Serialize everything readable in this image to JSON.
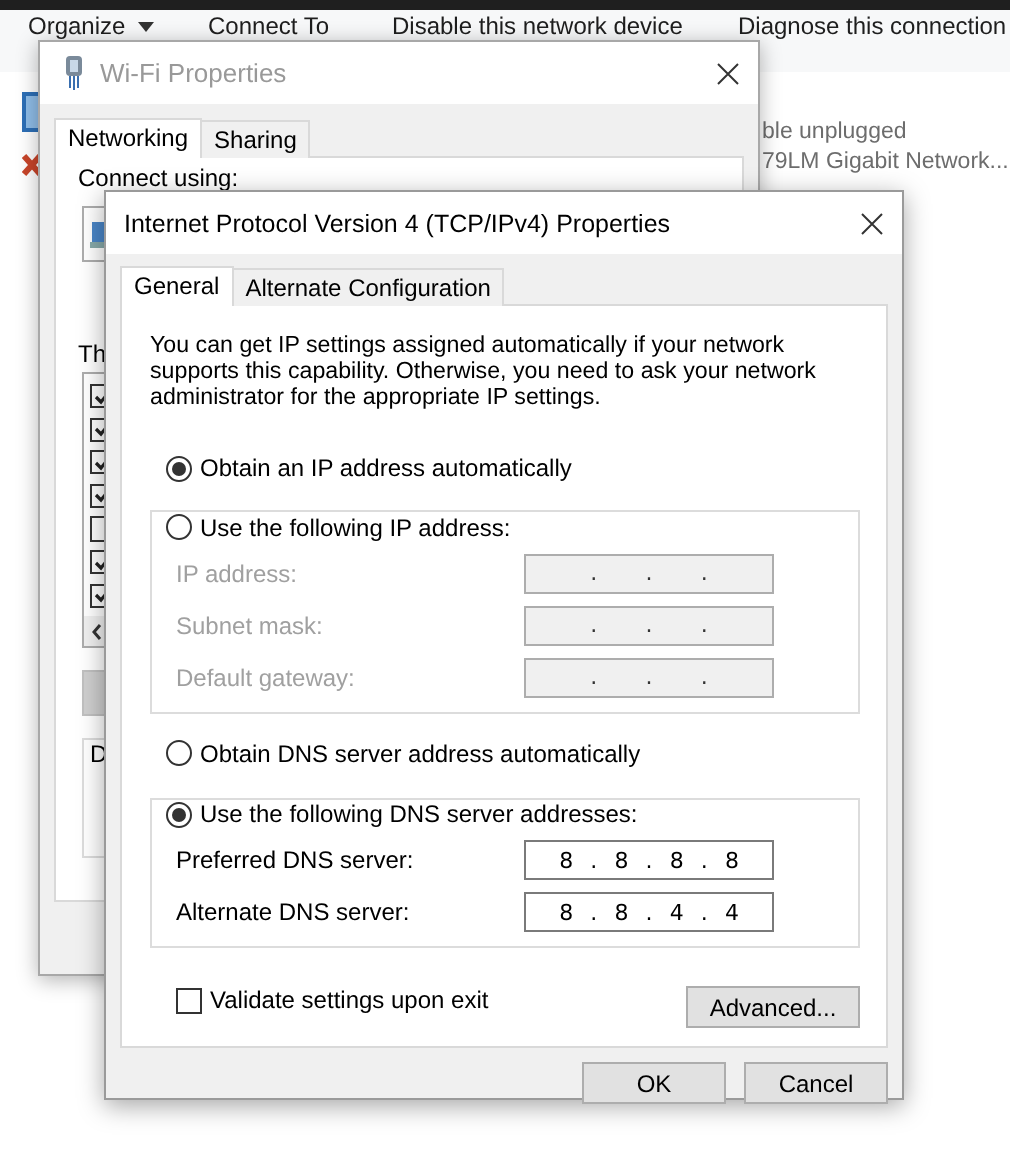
{
  "explorer": {
    "toolbar": [
      {
        "label": "Organize",
        "kind": "menu"
      },
      {
        "label": "Connect To",
        "kind": "button"
      },
      {
        "label": "Disable this network device",
        "kind": "button"
      },
      {
        "label": "Diagnose this connection",
        "kind": "button"
      }
    ],
    "adapter": {
      "status": "ble unplugged",
      "device": "79LM Gigabit Network...",
      "disconnected": true
    }
  },
  "wifi": {
    "title": "Wi-Fi Properties",
    "tabs": [
      {
        "label": "Networking",
        "selected": true
      },
      {
        "label": "Sharing",
        "selected": false
      }
    ],
    "connect_label": "Connect using:",
    "items_label": "Th",
    "items": [
      {
        "checked": true
      },
      {
        "checked": true
      },
      {
        "checked": true
      },
      {
        "checked": true
      },
      {
        "checked": false
      },
      {
        "checked": true
      },
      {
        "checked": true
      }
    ],
    "group_label": "D"
  },
  "ipv4": {
    "title": "Internet Protocol Version 4 (TCP/IPv4) Properties",
    "tabs": [
      {
        "label": "General",
        "selected": true
      },
      {
        "label": "Alternate Configuration",
        "selected": false
      }
    ],
    "intro": "You can get IP settings assigned automatically if your network supports this capability. Otherwise, you need to ask your network administrator for the appropriate IP settings.",
    "ip_mode": [
      {
        "label": "Obtain an IP address automatically",
        "selected": true
      },
      {
        "label": "Use the following IP address:",
        "selected": false
      }
    ],
    "ip_fields": [
      {
        "label": "IP address:",
        "value": ". . .",
        "disabled": true
      },
      {
        "label": "Subnet mask:",
        "value": ". . .",
        "disabled": true
      },
      {
        "label": "Default gateway:",
        "value": ". . .",
        "disabled": true
      }
    ],
    "dns_mode": [
      {
        "label": "Obtain DNS server address automatically",
        "selected": false
      },
      {
        "label": "Use the following DNS server addresses:",
        "selected": true
      }
    ],
    "dns_fields": [
      {
        "label": "Preferred DNS server:",
        "value": "8 . 8 . 8 . 8",
        "disabled": false
      },
      {
        "label": "Alternate DNS server:",
        "value": "8 . 8 . 4 . 4",
        "disabled": false
      }
    ],
    "validate": {
      "label": "Validate settings upon exit",
      "checked": false
    },
    "advanced": "Advanced...",
    "buttons": [
      "OK",
      "Cancel"
    ]
  }
}
